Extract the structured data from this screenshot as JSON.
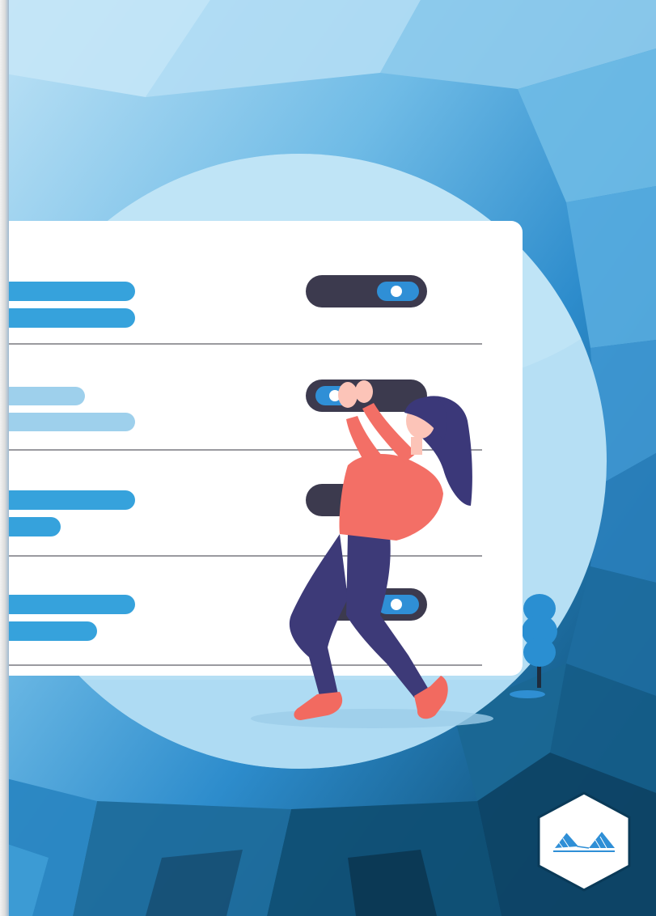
{
  "illustration": {
    "subject": "woman-flipping-toggle",
    "colors": {
      "bg_light": "#93cbe9",
      "bg_mid": "#3c9dd8",
      "bg_dark": "#0e4667",
      "circle": "#b9e0f4",
      "card": "#ffffff",
      "bar_primary": "#36a2dc",
      "bar_muted": "#9ed0ec",
      "toggle_track": "#3c3a4e",
      "toggle_pill": "#2f8fd6",
      "shirt": "#f36f66",
      "hair": "#3b3879",
      "pants": "#3d3a78",
      "skin": "#fcc4b8"
    },
    "settings_rows": [
      {
        "bar_widths": [
          "long",
          "long"
        ],
        "bar_style": "primary",
        "toggle": "on"
      },
      {
        "bar_widths": [
          "short",
          "long"
        ],
        "bar_style": "muted",
        "toggle": "off"
      },
      {
        "bar_widths": [
          "long",
          "short"
        ],
        "bar_style": "primary",
        "toggle": "hidden"
      },
      {
        "bar_widths": [
          "long",
          "medium"
        ],
        "bar_style": "primary",
        "toggle": "on"
      }
    ]
  },
  "logo": {
    "shape": "hexagon",
    "icon": "stylized-wave-mountain-logo"
  }
}
